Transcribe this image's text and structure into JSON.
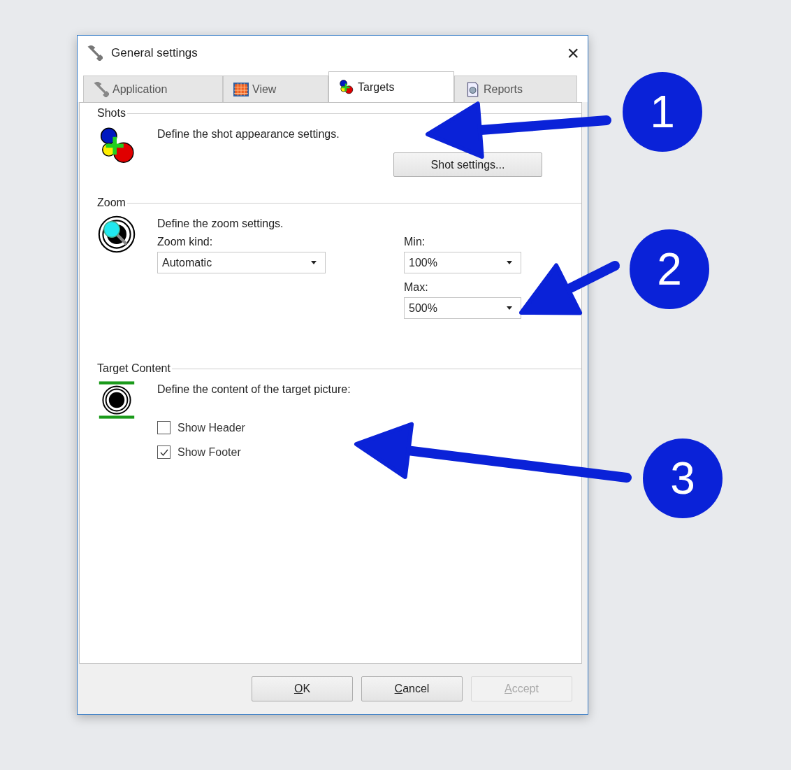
{
  "window": {
    "title": "General settings",
    "close": "×"
  },
  "tabs": [
    {
      "label": "Application",
      "kind": "wrench",
      "selected": false
    },
    {
      "label": "View",
      "kind": "grid",
      "selected": false
    },
    {
      "label": "Targets",
      "kind": "shots",
      "selected": true
    },
    {
      "label": "Reports",
      "kind": "report",
      "selected": false
    }
  ],
  "shots": {
    "title": "Shots",
    "description": "Define the shot appearance settings.",
    "button": "Shot settings..."
  },
  "zoom": {
    "title": "Zoom",
    "description": "Define the zoom settings.",
    "kind_label": "Zoom kind:",
    "kind_value": "Automatic",
    "min_label": "Min:",
    "min_value": "100%",
    "max_label": "Max:",
    "max_value": "500%"
  },
  "target_content": {
    "title": "Target Content",
    "description": "Define the content of the target picture:",
    "options": [
      {
        "label": "Show Header",
        "checked": false
      },
      {
        "label": "Show Footer",
        "checked": true
      }
    ]
  },
  "buttons": [
    {
      "key": "O",
      "after": "K",
      "disabled": false
    },
    {
      "key": "C",
      "after": "ancel",
      "disabled": false
    },
    {
      "key": "A",
      "after": "ccept",
      "disabled": true
    }
  ],
  "annotations": [
    {
      "label": "1"
    },
    {
      "label": "2"
    },
    {
      "label": "3"
    }
  ]
}
